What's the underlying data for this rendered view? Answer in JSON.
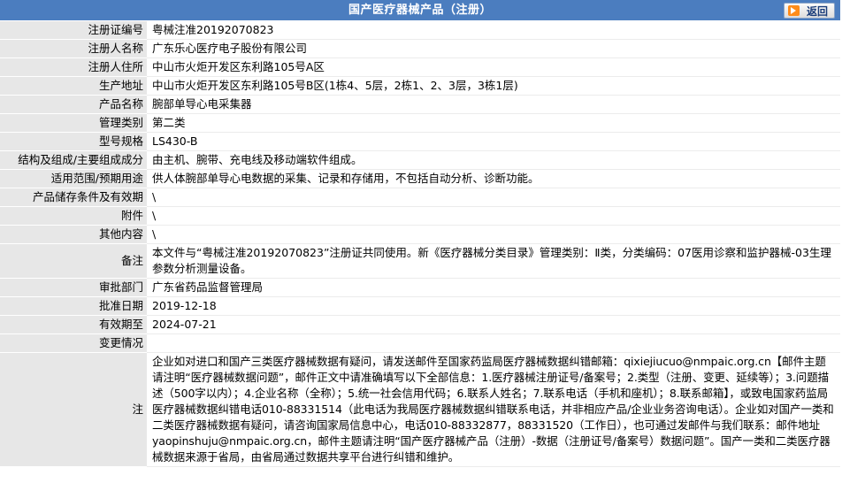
{
  "header": {
    "title": "国产医疗器械产品（注册）",
    "back_label": "返回"
  },
  "fields": [
    {
      "label": "注册证编号",
      "value": "粤械注准20192070823"
    },
    {
      "label": "注册人名称",
      "value": "广东乐心医疗电子股份有限公司"
    },
    {
      "label": "注册人住所",
      "value": "中山市火炬开发区东利路105号A区"
    },
    {
      "label": "生产地址",
      "value": "中山市火炬开发区东利路105号B区(1栋4、5层，2栋1、2、3层，3栋1层)"
    },
    {
      "label": "产品名称",
      "value": "腕部单导心电采集器"
    },
    {
      "label": "管理类别",
      "value": "第二类"
    },
    {
      "label": "型号规格",
      "value": "LS430-B"
    },
    {
      "label": "结构及组成/主要组成成分",
      "value": "由主机、腕带、充电线及移动端软件组成。"
    },
    {
      "label": "适用范围/预期用途",
      "value": "供人体腕部单导心电数据的采集、记录和存储用，不包括自动分析、诊断功能。"
    },
    {
      "label": "产品储存条件及有效期",
      "value": "\\"
    },
    {
      "label": "附件",
      "value": "\\"
    },
    {
      "label": "其他内容",
      "value": "\\"
    },
    {
      "label": "备注",
      "value": "本文件与“粤械注准20192070823”注册证共同使用。新《医疗器械分类目录》管理类别：Ⅱ类，分类编码：07医用诊察和监护器械-03生理参数分析测量设备。"
    },
    {
      "label": "审批部门",
      "value": "广东省药品监督管理局"
    },
    {
      "label": "批准日期",
      "value": "2019-12-18"
    },
    {
      "label": "有效期至",
      "value": "2024-07-21"
    },
    {
      "label": "变更情况",
      "value": ""
    }
  ],
  "note": {
    "label": "注",
    "text": "企业如对进口和国产三类医疗器械数据有疑问，请发送邮件至国家药监局医疗器械数据纠错邮箱：qixiejiucuo@nmpaic.org.cn【邮件主题请注明“医疗器械数据问题”，邮件正文中请准确填写以下全部信息：1.医疗器械注册证号/备案号；2.类型（注册、变更、延续等）；3.问题描述（500字以内）；4.企业名称（全称）；5.统一社会信用代码；6.联系人姓名；7.联系电话（手机和座机）；8.联系邮箱】，或致电国家药监局医疗器械数据纠错电话010-88331514（此电话为我局医疗器械数据纠错联系电话，并非相应产品/企业业务咨询电话）。企业如对国产一类和二类医疗器械数据有疑问，请咨询国家局信息中心，电话010-88332877，88331520（工作日），也可通过发邮件与我们联系：邮件地址yaopinshuju@nmpaic.org.cn，邮件主题请注明“国产医疗器械产品（注册）-数据（注册证号/备案号）数据问题”。国产一类和二类医疗器械数据来源于省局，由省局通过数据共享平台进行纠错和维护。"
  }
}
